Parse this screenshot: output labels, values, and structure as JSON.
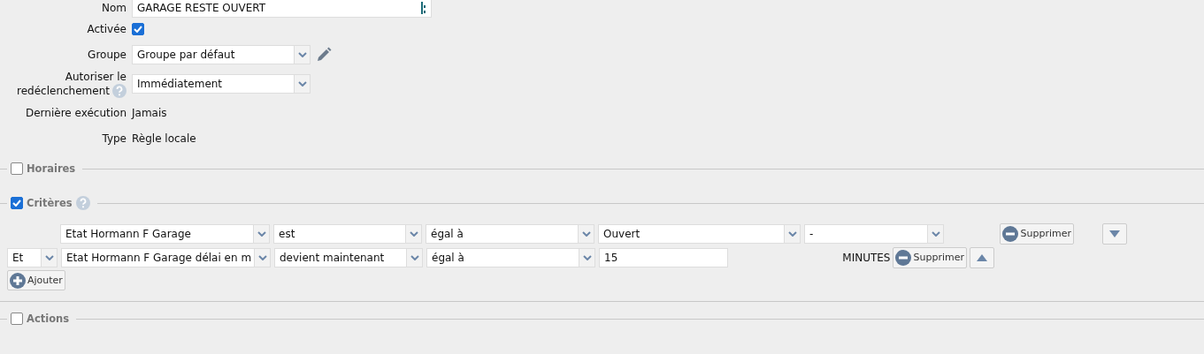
{
  "fields": [
    {
      "kind": "text",
      "label": "Nom",
      "value": "GARAGE RESTE OUVERT"
    },
    {
      "kind": "checkbox",
      "label": "Activée",
      "checked": true
    },
    {
      "kind": "select",
      "label": "Groupe",
      "value": "Groupe par défaut",
      "editable": true
    },
    {
      "kind": "select",
      "label": "Autoriser le",
      "label_2": "redéclenchement",
      "help": true,
      "value": "Immédiatement"
    },
    {
      "kind": "static",
      "label": "Dernière exécution",
      "value": "Jamais"
    },
    {
      "kind": "static",
      "label": "Type",
      "value": "Règle locale"
    }
  ],
  "sections_top": [
    {
      "title": "Horaires",
      "checked": false,
      "help": false
    },
    {
      "title": "Critères",
      "checked": true,
      "help": true
    }
  ],
  "criteria": [
    {
      "cells": [
        {
          "kind": "spacer"
        },
        {
          "kind": "select",
          "value": "Etat Hormann F Garage"
        },
        {
          "kind": "select",
          "value": "est"
        },
        {
          "kind": "select",
          "value": "égal à"
        },
        {
          "kind": "select",
          "value": "Ouvert"
        },
        {
          "kind": "select",
          "value": "-"
        }
      ],
      "remove": "Supprimer",
      "kind": "down"
    },
    {
      "cells": [
        {
          "kind": "conj",
          "value": "Et"
        },
        {
          "kind": "select",
          "value": "Etat Hormann F Garage délai en m"
        },
        {
          "kind": "select",
          "value": "devient maintenant"
        },
        {
          "kind": "select",
          "value": "égal à"
        },
        {
          "kind": "input",
          "value": "15"
        }
      ],
      "unit": "MINUTES",
      "remove": "Supprimer",
      "kind": "up"
    }
  ],
  "add_button": "Ajouter",
  "sections_bottom": [
    {
      "title": "Actions",
      "checked": false,
      "help": false
    }
  ]
}
